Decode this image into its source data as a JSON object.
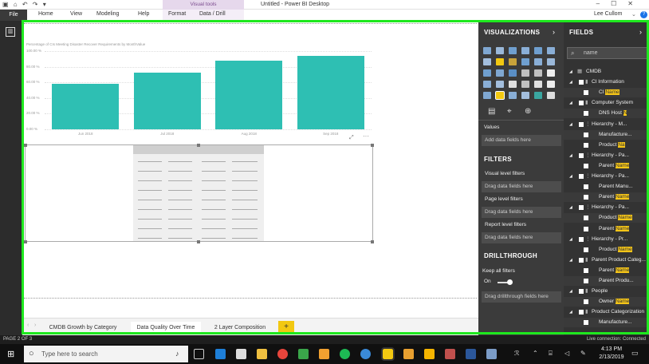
{
  "app": {
    "title": "Untitled - Power BI Desktop",
    "context_tab": "Visual tools",
    "user": "Lee Cullom"
  },
  "menu": {
    "file": "File",
    "home": "Home",
    "view": "View",
    "modeling": "Modeling",
    "help": "Help",
    "format": "Format",
    "data_drill": "Data / Drill"
  },
  "chart_data": {
    "type": "bar",
    "title": "Percentage of CIs Meeting Disaster Recover Requirements by MonthValue",
    "categories": [
      "Jun 2018",
      "Jul 2018",
      "Aug 2018",
      "Sep 2018"
    ],
    "values": [
      58,
      72,
      88,
      94
    ],
    "ylim": [
      0,
      100
    ],
    "yticks": [
      "0.00 %",
      "20.00 %",
      "40.00 %",
      "60.00 %",
      "80.00 %",
      "100.00 %"
    ],
    "color": "#2ebfb3",
    "grid": true
  },
  "tabs": {
    "items": [
      "CMDB Growth by Category",
      "Data Quality Over Time",
      "2 Layer Composition"
    ],
    "active_index": 1,
    "add_label": "+"
  },
  "viz_pane": {
    "title": "VISUALIZATIONS",
    "values_label": "Values",
    "add_fields": "Add data fields here",
    "filters_title": "FILTERS",
    "visual_filters": "Visual level filters",
    "drag_fields": "Drag data fields here",
    "page_filters": "Page level filters",
    "report_filters": "Report level filters",
    "drillthrough_title": "DRILLTHROUGH",
    "keep_filters": "Keep all filters",
    "toggle_state": "On",
    "drag_drillthrough": "Drag drillthrough fields here"
  },
  "fields_pane": {
    "title": "FIELDS",
    "search_placeholder": "name",
    "highlight_color": "#f5c518",
    "rows": [
      {
        "label": "CMDB",
        "indent": 0,
        "type": "table"
      },
      {
        "label": "CI Information",
        "indent": 1,
        "type": "folder"
      },
      {
        "label": "CI ",
        "hl": "Name",
        "indent": 2,
        "type": "field"
      },
      {
        "label": "Computer System",
        "indent": 1,
        "type": "folder"
      },
      {
        "label": "DNS Host ",
        "hl": "N",
        "indent": 2,
        "type": "field"
      },
      {
        "label": "Hierarchy - M...",
        "indent": 1,
        "type": "hier"
      },
      {
        "label": "Manufacture...",
        "hl": "",
        "indent": 2,
        "type": "field"
      },
      {
        "label": "Product ",
        "hl": "Na",
        "indent": 2,
        "type": "field"
      },
      {
        "label": "Hierarchy - Pa...",
        "indent": 1,
        "type": "hier"
      },
      {
        "label": "Parent ",
        "hl": "Name",
        "indent": 2,
        "type": "field"
      },
      {
        "label": "Hierarchy - Pa...",
        "indent": 1,
        "type": "hier"
      },
      {
        "label": "Parent Manu...",
        "indent": 2,
        "type": "field"
      },
      {
        "label": "Parent ",
        "hl": "Name",
        "indent": 2,
        "type": "field"
      },
      {
        "label": "Hierarchy - Pa...",
        "indent": 1,
        "type": "hier"
      },
      {
        "label": "Product ",
        "hl": "Name",
        "indent": 2,
        "type": "field"
      },
      {
        "label": "Parent ",
        "hl": "Name",
        "indent": 2,
        "type": "field"
      },
      {
        "label": "Hierarchy - Pr...",
        "indent": 1,
        "type": "hier"
      },
      {
        "label": "Product ",
        "hl": "Name",
        "indent": 2,
        "type": "field"
      },
      {
        "label": "Parent Product Categ...",
        "indent": 1,
        "type": "folder"
      },
      {
        "label": "Parent ",
        "hl": "Name",
        "indent": 2,
        "type": "field"
      },
      {
        "label": "Parent Produ...",
        "indent": 2,
        "type": "field"
      },
      {
        "label": "People",
        "indent": 1,
        "type": "folder"
      },
      {
        "label": "Owner ",
        "hl": "Name",
        "indent": 2,
        "type": "field"
      },
      {
        "label": "Product Categorization",
        "indent": 1,
        "type": "folder"
      },
      {
        "label": "Manufacture...",
        "hl": "",
        "indent": 2,
        "type": "field"
      }
    ]
  },
  "status": {
    "page": "PAGE 2 OF 3",
    "connection": "Live connection: Connected"
  },
  "taskbar": {
    "search_placeholder": "Type here to search",
    "time": "4:13 PM",
    "date": "2/13/2019"
  }
}
